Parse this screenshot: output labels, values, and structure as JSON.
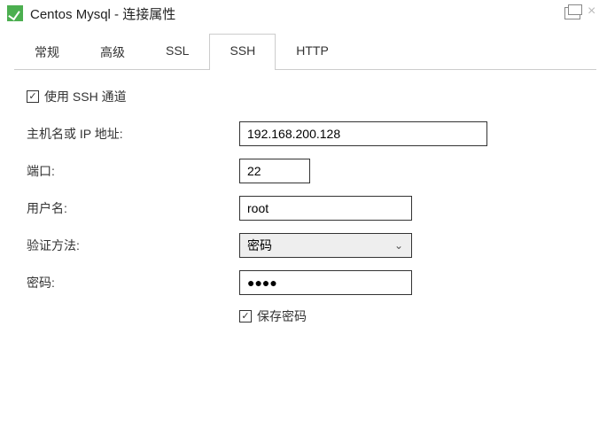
{
  "window": {
    "title": "Centos Mysql - 连接属性"
  },
  "tabs": {
    "general": "常规",
    "advanced": "高级",
    "ssl": "SSL",
    "ssh": "SSH",
    "http": "HTTP",
    "active": "ssh"
  },
  "ssh": {
    "use_tunnel_label": "使用 SSH 通道",
    "use_tunnel_checked": true,
    "host_label": "主机名或 IP 地址:",
    "host_value": "192.168.200.128",
    "port_label": "端口:",
    "port_value": "22",
    "user_label": "用户名:",
    "user_value": "root",
    "auth_label": "验证方法:",
    "auth_value": "密码",
    "password_label": "密码:",
    "password_masked": "●●●●",
    "save_password_label": "保存密码",
    "save_password_checked": true
  }
}
